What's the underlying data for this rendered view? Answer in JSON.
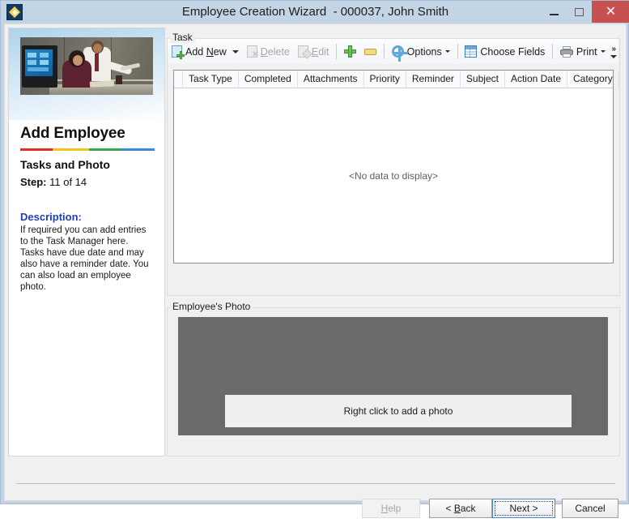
{
  "window": {
    "title": "Employee Creation Wizard  - 000037, John Smith",
    "app_icon": "diamond-app-icon",
    "controls": {
      "minimize": "minimize-icon",
      "maximize": "maximize-icon",
      "close": "✕",
      "close_color": "#c75050"
    }
  },
  "sidebar": {
    "hero_image_alt": "two office workers at a computer workstation",
    "title": "Add Employee",
    "color_bar": [
      "#e03127",
      "#f5c319",
      "#34a853",
      "#3b86e0"
    ],
    "subtitle": "Tasks and Photo",
    "step_label": "Step:",
    "step_value": "11 of 14",
    "description_heading": "Description:",
    "description_heading_color": "#1f3fb5",
    "description_text": "If required you can add entries to the Task Manager here. Tasks have due date and may also have a reminder date. You can also load an employee photo."
  },
  "task_group": {
    "legend": "Task",
    "toolbar": [
      {
        "id": "add-new",
        "label": "Add New",
        "icon": "page-add-icon",
        "underline": "N",
        "disabled": false,
        "dropdown": true
      },
      {
        "id": "delete",
        "label": "Delete",
        "icon": "page-delete-icon",
        "underline": "D",
        "disabled": true,
        "dropdown": false
      },
      {
        "id": "edit",
        "label": "Edit",
        "icon": "page-edit-icon",
        "underline": "E",
        "disabled": true,
        "dropdown": false
      },
      {
        "id": "add-row",
        "label": "",
        "icon": "plus-icon",
        "disabled": false,
        "dropdown": false
      },
      {
        "id": "remove-row",
        "label": "",
        "icon": "minus-icon",
        "disabled": false,
        "dropdown": false
      },
      {
        "id": "options",
        "label": "Options",
        "icon": "gear-icon",
        "disabled": false,
        "dropdown": true
      },
      {
        "id": "choose-fields",
        "label": "Choose Fields",
        "icon": "grid-icon",
        "disabled": false,
        "dropdown": false
      },
      {
        "id": "print",
        "label": "Print",
        "icon": "printer-icon",
        "disabled": false,
        "dropdown": true
      }
    ],
    "overflow_label": "»",
    "grid": {
      "columns": [
        "Task Type",
        "Completed",
        "Attachments",
        "Priority",
        "Reminder",
        "Subject",
        "Action Date",
        "Category"
      ],
      "rows": [],
      "empty_text": "<No data to display>"
    }
  },
  "photo_group": {
    "legend": "Employee's Photo",
    "placeholder_color": "#6a6a6a",
    "hint_text": "Right click to add a photo"
  },
  "footer": {
    "buttons": [
      {
        "id": "help",
        "label": "Help",
        "underline": "H",
        "disabled": true,
        "default": false
      },
      {
        "id": "back",
        "label": "< Back",
        "underline": "B",
        "disabled": false,
        "default": false
      },
      {
        "id": "next",
        "label": "Next >",
        "underline": "",
        "disabled": false,
        "default": true
      },
      {
        "id": "cancel",
        "label": "Cancel",
        "underline": "",
        "disabled": false,
        "default": false
      }
    ]
  }
}
